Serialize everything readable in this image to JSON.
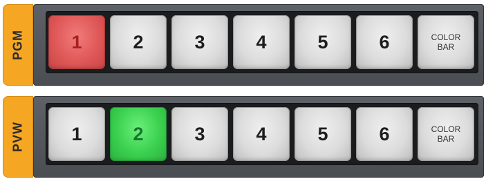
{
  "pgm": {
    "label": "PGM",
    "buttons": [
      "1",
      "2",
      "3",
      "4",
      "5",
      "6",
      "COLOR\nBAR"
    ],
    "active_index": 0,
    "active_color": "#e05858"
  },
  "pvw": {
    "label": "PVW",
    "buttons": [
      "1",
      "2",
      "3",
      "4",
      "5",
      "6",
      "COLOR\nBAR"
    ],
    "active_index": 1,
    "active_color": "#3bd04f"
  },
  "colors": {
    "tab": "#f5a623",
    "strip": "#55585d",
    "well": "#1b1c1e",
    "button": "#dcdcdc"
  }
}
